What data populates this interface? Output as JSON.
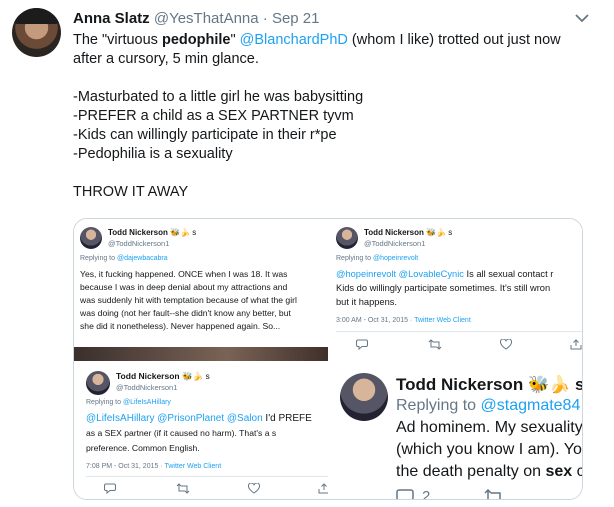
{
  "tweet": {
    "name": "Anna Slatz",
    "handle": "@YesThatAnna",
    "dot": "·",
    "date": "Sep 21",
    "line1_pre": "The \"virtuous ",
    "line1_kw": "pedophile",
    "line1_mid": "\" ",
    "line1_mention": "@BlanchardPhD",
    "line1_post": " (whom I like) trotted out just now",
    "line2": "after a cursory, 5 min glance.",
    "list": [
      "-Masturbated to a little girl he was babysitting",
      "-PREFER a child as a SEX PARTNER tyvm",
      "-Kids can willingly participate in their r*pe",
      "-Pedophilia is a sexuality"
    ],
    "closing": "THROW IT AWAY"
  },
  "media": {
    "p1": {
      "name": "Todd Nickerson",
      "emoji": "🐝🍌 s",
      "handle": "@ToddNickerson1",
      "reply_pre": "Replying to ",
      "reply_to": "@dajewbacabra",
      "lines": [
        "Yes, it fucking happened. ONCE when I was 18. It was",
        "because I was in deep denial about my attractions and",
        "was suddenly hit with temptation because of what the girl",
        "was doing (not her fault--she didn't know any better, but",
        "she did it nonetheless). Never happened again. So..."
      ]
    },
    "p2": {
      "name": "Todd Nickerson",
      "emoji": "🐝🍌 s",
      "handle": "@ToddNickerson1",
      "reply_pre": "Replying to ",
      "reply_to": "@hopeinrevolt",
      "line1_m1": "@hopeinrevolt",
      "line1_m2": " @LovableCynic",
      "line1_post": "  Is all sexual contact r",
      "line2": "Kids do willingly participate sometimes.  It's still wron",
      "line3": "but it happens.",
      "meta": "3:00 AM - Oct 31, 2015 · ",
      "client": "Twitter Web Client"
    },
    "p3": {
      "name": "Todd Nickerson",
      "emoji": "🐝🍌 s",
      "handle": "@ToddNickerson1",
      "reply_pre": "Replying to ",
      "reply_to": "@LifeIsAHillary",
      "line1_m": "@LifeIsAHillary @PrisonPlanet @Salon",
      "line1_post": " I'd PREFE",
      "line2": "as a SEX partner (if it caused no harm). That's a s",
      "line3": "preference. Common English.",
      "meta": "7:08 PM - Oct 31, 2015 · ",
      "client": "Twitter Web Client"
    },
    "p4": {
      "name": "Todd Nickerson",
      "emoji": "🐝🍌 s",
      "reply_pre": "Replying to ",
      "reply_to": "@stagmate84",
      "line1": "Ad hominem. My sexuality",
      "line2": "(which you know I am). Yo",
      "line3_pre": "the death penalty on ",
      "line3_kw": "sex",
      "line3_post": " c",
      "reply_count": "2"
    }
  }
}
